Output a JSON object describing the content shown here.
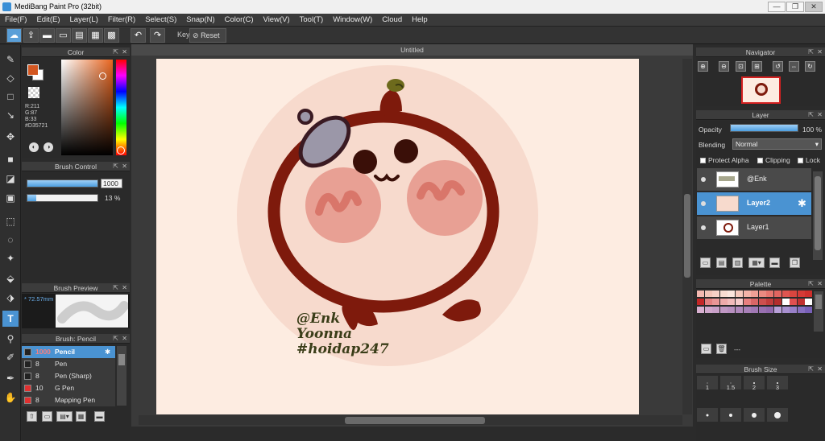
{
  "window": {
    "title": "MediBang Paint Pro (32bit)",
    "min": "—",
    "max": "❐",
    "close": "✕"
  },
  "menu": [
    "File(F)",
    "Edit(E)",
    "Layer(L)",
    "Filter(R)",
    "Select(S)",
    "Snap(N)",
    "Color(C)",
    "View(V)",
    "Tool(T)",
    "Window(W)",
    "Cloud",
    "Help"
  ],
  "toolbar": {
    "key_label": "Key",
    "reset_label": "Reset"
  },
  "color_panel": {
    "title": "Color",
    "r": "R:211",
    "g": "G:87",
    "b": "B:33",
    "hex": "#D35721",
    "primary": "#D35721"
  },
  "brush_control": {
    "title": "Brush Control",
    "size_value": "1000",
    "opacity_value": "13 %",
    "size_fraction": 1.0,
    "opacity_fraction": 0.13
  },
  "brush_preview": {
    "title": "Brush Preview",
    "size": "* 72.57mm"
  },
  "brush_list": {
    "title": "Brush: Pencil",
    "items": [
      {
        "size": "1000",
        "name": "Pencil",
        "color": "#222222"
      },
      {
        "size": "8",
        "name": "Pen",
        "color": "#222222"
      },
      {
        "size": "8",
        "name": "Pen (Sharp)",
        "color": "#222222"
      },
      {
        "size": "10",
        "name": "G Pen",
        "color": "#e03030"
      },
      {
        "size": "8",
        "name": "Mapping Pen",
        "color": "#e03030"
      }
    ]
  },
  "canvas": {
    "tab": "Untitled",
    "line1": "@Enk",
    "line2": "Yoonna",
    "line3": "#hoidap247"
  },
  "navigator": {
    "title": "Navigator"
  },
  "layer_panel": {
    "title": "Layer",
    "opacity_label": "Opacity",
    "opacity_value": "100 %",
    "opacity_fraction": 1.0,
    "blending_label": "Blending",
    "blending_value": "Normal",
    "protect_alpha": "Protect Alpha",
    "clipping": "Clipping",
    "lock": "Lock",
    "layers": [
      {
        "name": "@Enk",
        "selected": false
      },
      {
        "name": "Layer2",
        "selected": true
      },
      {
        "name": "Layer1",
        "selected": false
      }
    ]
  },
  "palette": {
    "title": "Palette",
    "dashes": "---",
    "colors": [
      "#f4b8b0",
      "#f3c4b8",
      "#f6d0c6",
      "#f8dcd2",
      "#fbe6de",
      "#f6c9bd",
      "#f3b3a8",
      "#ee9f95",
      "#eb8a81",
      "#e6756e",
      "#e26560",
      "#de5550",
      "#d9463f",
      "#d43a36",
      "#ce2f2c",
      "#c42727",
      "#e38080",
      "#e99696",
      "#eeaaaa",
      "#f2bbbb",
      "#f6cbcb",
      "#e87f7f",
      "#d96666",
      "#cc4f4f",
      "#c03c3c",
      "#b32d2d",
      "#ffffff",
      "#e05050",
      "#c03030",
      "#ffffff",
      "#d8b0d0",
      "#d0a8cc",
      "#c8a0c8",
      "#c098c4",
      "#b890c0",
      "#b088bc",
      "#a880b8",
      "#a078b4",
      "#9870b0",
      "#9068ac",
      "#b8a0d8",
      "#a890d0",
      "#9880c8",
      "#8870c0",
      "#7860b8"
    ]
  },
  "brush_size_panel": {
    "title": "Brush Size",
    "sizes": [
      "1",
      "1.5",
      "2",
      "3"
    ]
  }
}
